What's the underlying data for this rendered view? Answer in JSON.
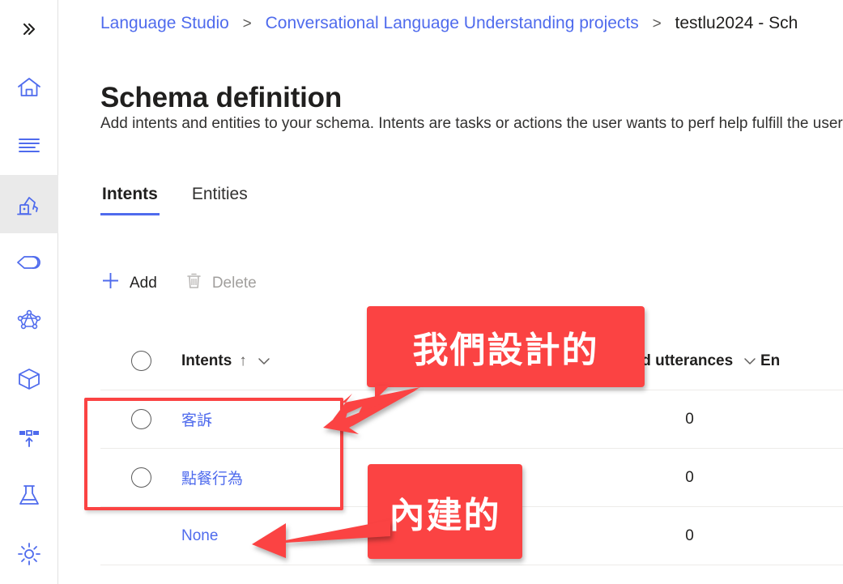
{
  "rail": {
    "items": [
      {
        "icon": "double-chevron-right-icon",
        "name": "expand-menu"
      },
      {
        "icon": "home-icon",
        "name": "home"
      },
      {
        "icon": "text-lines-icon",
        "name": "text-analytics"
      },
      {
        "icon": "robot-arm-icon",
        "name": "schema-definition",
        "selected": true
      },
      {
        "icon": "tag-icon",
        "name": "label-data"
      },
      {
        "icon": "network-graph-icon",
        "name": "training-jobs"
      },
      {
        "icon": "box-package-icon",
        "name": "model-performance"
      },
      {
        "icon": "deploy-upload-icon",
        "name": "deploying-model"
      },
      {
        "icon": "flask-icon",
        "name": "testing-deployments"
      },
      {
        "icon": "gear-icon",
        "name": "project-settings"
      }
    ]
  },
  "breadcrumb": {
    "items": [
      {
        "label": "Language Studio",
        "link": true
      },
      {
        "label": "Conversational Language Understanding projects",
        "link": true
      },
      {
        "label": "testlu2024 - Sch",
        "link": false
      }
    ],
    "separator": ">"
  },
  "page": {
    "title": "Schema definition",
    "description": "Add intents and entities to your schema. Intents are tasks or actions the user wants to perf help fulfill the user’s intent."
  },
  "tabs": [
    {
      "label": "Intents",
      "active": true
    },
    {
      "label": "Entities",
      "active": false
    }
  ],
  "commandbar": {
    "add": {
      "label": "Add",
      "icon": "plus-icon",
      "enabled": true
    },
    "delete": {
      "label": "Delete",
      "icon": "trash-icon",
      "enabled": false
    }
  },
  "table": {
    "headers": {
      "select": "",
      "intents": "Intents",
      "sort_indicator": "↑",
      "utterances": "eled utterances",
      "entities": "En"
    },
    "rows": [
      {
        "name": "客訴",
        "utterances": "0",
        "entities": "",
        "selectable": true
      },
      {
        "name": "點餐行為",
        "utterances": "0",
        "entities": "",
        "selectable": true
      },
      {
        "name": "None",
        "utterances": "0",
        "entities": "",
        "selectable": false
      }
    ]
  },
  "annotations": {
    "box1": {
      "text": "我們設計的"
    },
    "box2": {
      "text": "內建的"
    },
    "color": "#fb4343"
  },
  "colors": {
    "accent": "#4f6bed",
    "link": "#4f6bed",
    "annotation_red": "#fb4343",
    "rail_selected_bg": "#eaeaea"
  }
}
